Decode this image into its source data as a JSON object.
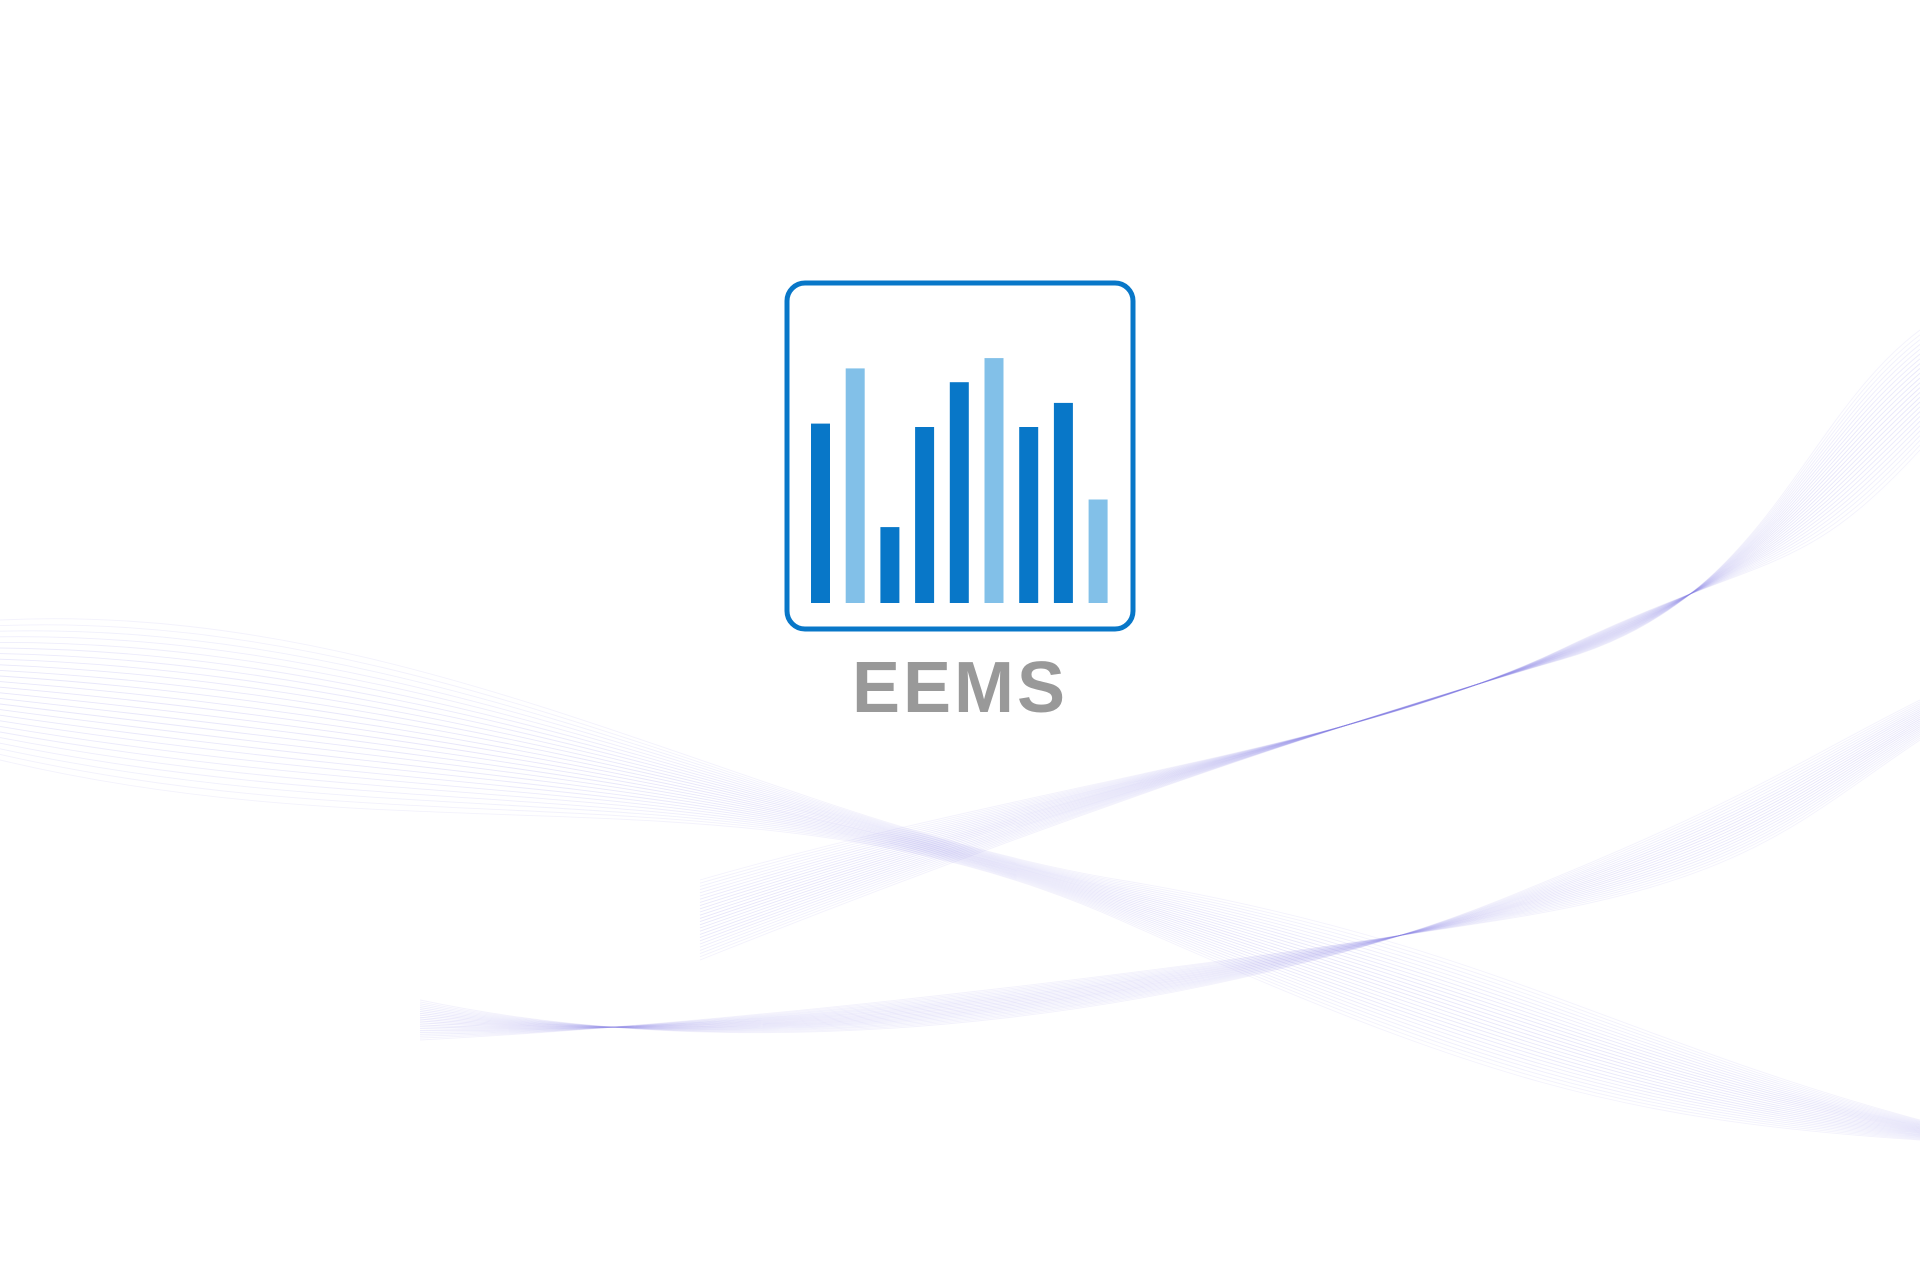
{
  "splash": {
    "app_name": "EEMS"
  },
  "logo": {
    "bar_levels": [
      0.52,
      0.68,
      0.22,
      0.51,
      0.64,
      0.71,
      0.51,
      0.58,
      0.3
    ],
    "bar_shades": [
      "dark",
      "light",
      "dark",
      "dark",
      "dark",
      "light",
      "dark",
      "dark",
      "light"
    ]
  },
  "colors": {
    "brand_blue": "#0877c8",
    "light_blue": "#82c0e8",
    "text_gray": "#999999",
    "wave_line": "#8a84e6"
  },
  "icons": {
    "logo": "bar-chart-logo-icon"
  }
}
